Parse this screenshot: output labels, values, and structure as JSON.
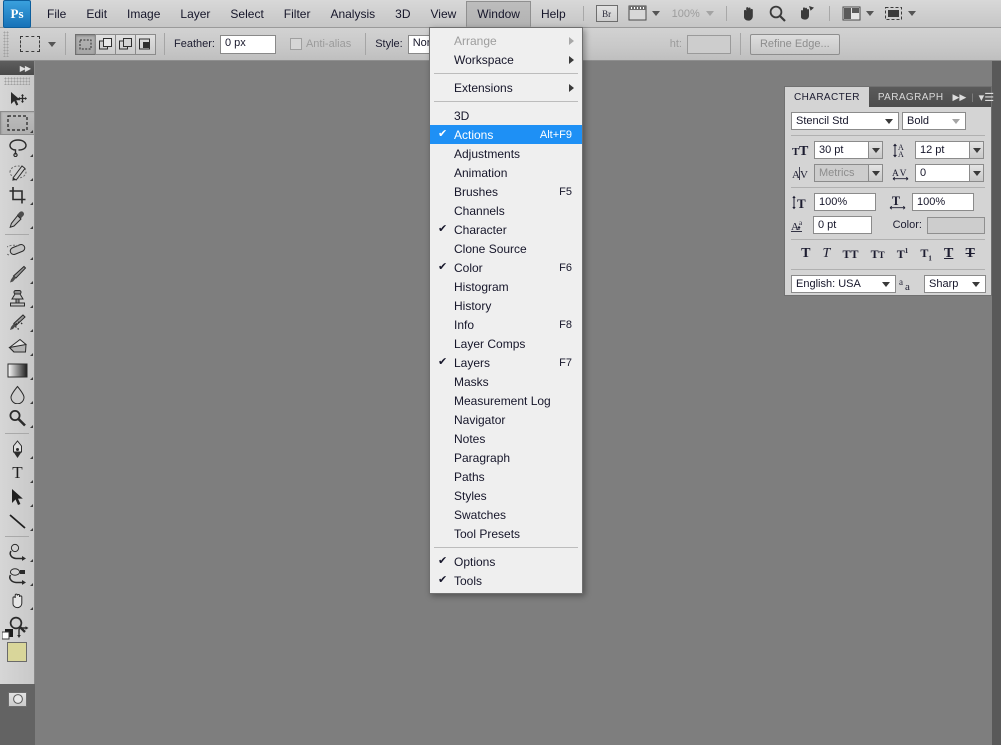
{
  "app": {
    "name": "Adobe Photoshop",
    "logo_text": "Ps"
  },
  "menubar": {
    "items": [
      {
        "label": "File",
        "active": false
      },
      {
        "label": "Edit",
        "active": false
      },
      {
        "label": "Image",
        "active": false
      },
      {
        "label": "Layer",
        "active": false
      },
      {
        "label": "Select",
        "active": false
      },
      {
        "label": "Filter",
        "active": false
      },
      {
        "label": "Analysis",
        "active": false
      },
      {
        "label": "3D",
        "active": false
      },
      {
        "label": "View",
        "active": false
      },
      {
        "label": "Window",
        "active": true
      },
      {
        "label": "Help",
        "active": false
      }
    ],
    "bridge_label": "Br",
    "zoom_level": "100%"
  },
  "options_bar": {
    "feather_label": "Feather:",
    "feather_value": "0 px",
    "antialias_label": "Anti-alias",
    "style_label": "Style:",
    "style_value": "Normal",
    "height_label_partial": "ht:",
    "refine_edge_label": "Refine Edge..."
  },
  "window_menu": {
    "items": [
      {
        "label": "Arrange",
        "checked": false,
        "shortcut": "",
        "submenu": true,
        "disabled": true,
        "highlighted": false
      },
      {
        "label": "Workspace",
        "checked": false,
        "shortcut": "",
        "submenu": true,
        "disabled": false,
        "highlighted": false
      },
      {
        "separator": true
      },
      {
        "label": "Extensions",
        "checked": false,
        "shortcut": "",
        "submenu": true,
        "disabled": false,
        "highlighted": false
      },
      {
        "separator": true
      },
      {
        "label": "3D",
        "checked": false,
        "shortcut": "",
        "submenu": false,
        "disabled": false,
        "highlighted": false
      },
      {
        "label": "Actions",
        "checked": true,
        "shortcut": "Alt+F9",
        "submenu": false,
        "disabled": false,
        "highlighted": true
      },
      {
        "label": "Adjustments",
        "checked": false,
        "shortcut": "",
        "submenu": false,
        "disabled": false,
        "highlighted": false
      },
      {
        "label": "Animation",
        "checked": false,
        "shortcut": "",
        "submenu": false,
        "disabled": false,
        "highlighted": false
      },
      {
        "label": "Brushes",
        "checked": false,
        "shortcut": "F5",
        "submenu": false,
        "disabled": false,
        "highlighted": false
      },
      {
        "label": "Channels",
        "checked": false,
        "shortcut": "",
        "submenu": false,
        "disabled": false,
        "highlighted": false
      },
      {
        "label": "Character",
        "checked": true,
        "shortcut": "",
        "submenu": false,
        "disabled": false,
        "highlighted": false
      },
      {
        "label": "Clone Source",
        "checked": false,
        "shortcut": "",
        "submenu": false,
        "disabled": false,
        "highlighted": false
      },
      {
        "label": "Color",
        "checked": true,
        "shortcut": "F6",
        "submenu": false,
        "disabled": false,
        "highlighted": false
      },
      {
        "label": "Histogram",
        "checked": false,
        "shortcut": "",
        "submenu": false,
        "disabled": false,
        "highlighted": false
      },
      {
        "label": "History",
        "checked": false,
        "shortcut": "",
        "submenu": false,
        "disabled": false,
        "highlighted": false
      },
      {
        "label": "Info",
        "checked": false,
        "shortcut": "F8",
        "submenu": false,
        "disabled": false,
        "highlighted": false
      },
      {
        "label": "Layer Comps",
        "checked": false,
        "shortcut": "",
        "submenu": false,
        "disabled": false,
        "highlighted": false
      },
      {
        "label": "Layers",
        "checked": true,
        "shortcut": "F7",
        "submenu": false,
        "disabled": false,
        "highlighted": false
      },
      {
        "label": "Masks",
        "checked": false,
        "shortcut": "",
        "submenu": false,
        "disabled": false,
        "highlighted": false
      },
      {
        "label": "Measurement Log",
        "checked": false,
        "shortcut": "",
        "submenu": false,
        "disabled": false,
        "highlighted": false
      },
      {
        "label": "Navigator",
        "checked": false,
        "shortcut": "",
        "submenu": false,
        "disabled": false,
        "highlighted": false
      },
      {
        "label": "Notes",
        "checked": false,
        "shortcut": "",
        "submenu": false,
        "disabled": false,
        "highlighted": false
      },
      {
        "label": "Paragraph",
        "checked": false,
        "shortcut": "",
        "submenu": false,
        "disabled": false,
        "highlighted": false
      },
      {
        "label": "Paths",
        "checked": false,
        "shortcut": "",
        "submenu": false,
        "disabled": false,
        "highlighted": false
      },
      {
        "label": "Styles",
        "checked": false,
        "shortcut": "",
        "submenu": false,
        "disabled": false,
        "highlighted": false
      },
      {
        "label": "Swatches",
        "checked": false,
        "shortcut": "",
        "submenu": false,
        "disabled": false,
        "highlighted": false
      },
      {
        "label": "Tool Presets",
        "checked": false,
        "shortcut": "",
        "submenu": false,
        "disabled": false,
        "highlighted": false
      },
      {
        "separator": true
      },
      {
        "label": "Options",
        "checked": true,
        "shortcut": "",
        "submenu": false,
        "disabled": false,
        "highlighted": false
      },
      {
        "label": "Tools",
        "checked": true,
        "shortcut": "",
        "submenu": false,
        "disabled": false,
        "highlighted": false
      }
    ],
    "checkmark_glyph": "✔",
    "highlight_color": "#1e90f5"
  },
  "toolbar": {
    "tools": [
      {
        "name": "move-tool",
        "selected": false,
        "has_flyout": false
      },
      {
        "name": "rectangular-marquee-tool",
        "selected": true,
        "has_flyout": true
      },
      {
        "name": "lasso-tool",
        "selected": false,
        "has_flyout": true
      },
      {
        "name": "quick-selection-tool",
        "selected": false,
        "has_flyout": true
      },
      {
        "name": "crop-tool",
        "selected": false,
        "has_flyout": true
      },
      {
        "name": "eyedropper-tool",
        "selected": false,
        "has_flyout": true
      },
      {
        "name": "healing-brush-tool",
        "selected": false,
        "has_flyout": true
      },
      {
        "name": "brush-tool",
        "selected": false,
        "has_flyout": true
      },
      {
        "name": "clone-stamp-tool",
        "selected": false,
        "has_flyout": true
      },
      {
        "name": "history-brush-tool",
        "selected": false,
        "has_flyout": true
      },
      {
        "name": "eraser-tool",
        "selected": false,
        "has_flyout": true
      },
      {
        "name": "gradient-tool",
        "selected": false,
        "has_flyout": true
      },
      {
        "name": "blur-tool",
        "selected": false,
        "has_flyout": true
      },
      {
        "name": "dodge-tool",
        "selected": false,
        "has_flyout": true
      },
      {
        "name": "pen-tool",
        "selected": false,
        "has_flyout": true
      },
      {
        "name": "horizontal-type-tool",
        "selected": false,
        "has_flyout": true
      },
      {
        "name": "path-selection-tool",
        "selected": false,
        "has_flyout": true
      },
      {
        "name": "line-tool",
        "selected": false,
        "has_flyout": true
      },
      {
        "name": "3d-rotate-tool",
        "selected": false,
        "has_flyout": true
      },
      {
        "name": "3d-orbit-tool",
        "selected": false,
        "has_flyout": true
      },
      {
        "name": "hand-tool",
        "selected": false,
        "has_flyout": true
      },
      {
        "name": "zoom-tool",
        "selected": false,
        "has_flyout": false
      }
    ],
    "foreground_color": "#d9d69a",
    "background_color": "#8f8040"
  },
  "character_panel": {
    "tabs": [
      {
        "label": "CHARACTER",
        "active": true
      },
      {
        "label": "PARAGRAPH",
        "active": false
      }
    ],
    "font_family": "Stencil Std",
    "font_style": "Bold",
    "font_size": "30 pt",
    "leading": "12 pt",
    "kerning": "Metrics",
    "tracking": "0",
    "vertical_scale": "100%",
    "horizontal_scale": "100%",
    "baseline_shift": "0 pt",
    "color_label": "Color:",
    "style_buttons": [
      {
        "name": "faux-bold-button",
        "glyph": "T"
      },
      {
        "name": "faux-italic-button",
        "glyph": "T"
      },
      {
        "name": "all-caps-button",
        "glyph": "TT"
      },
      {
        "name": "small-caps-button",
        "glyph": "Tт"
      },
      {
        "name": "superscript-button",
        "glyph": "T¹"
      },
      {
        "name": "subscript-button",
        "glyph": "T₁"
      },
      {
        "name": "underline-button",
        "glyph": "T"
      },
      {
        "name": "strikethrough-button",
        "glyph": "T"
      }
    ],
    "language": "English: USA",
    "antialias_method": "Sharp",
    "antialias_icon_label": "aa"
  },
  "canvas": {
    "background_color": "#7e7e7e"
  }
}
